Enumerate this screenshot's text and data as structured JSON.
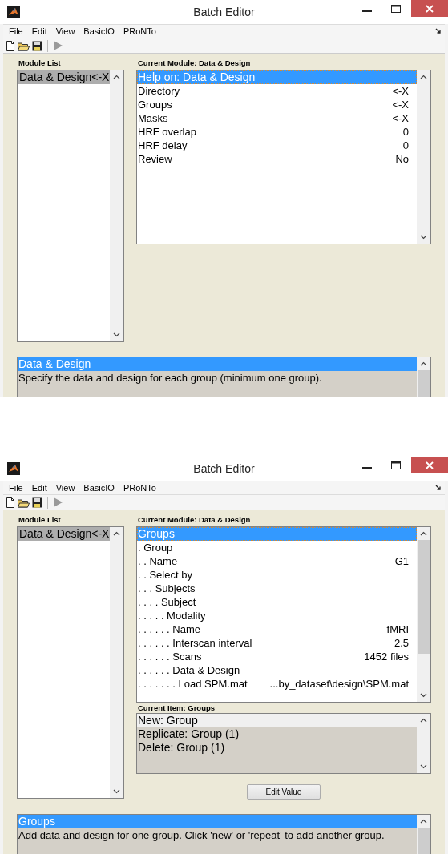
{
  "windows": [
    {
      "title": "Batch Editor",
      "menu": [
        "File",
        "Edit",
        "View",
        "BasicIO",
        "PRoNTo"
      ],
      "module_list_label": "Module List",
      "modules": [
        {
          "label": "Data & Design<-X",
          "selected": true
        }
      ],
      "current_module_label": "Current Module: Data & Design",
      "items": [
        {
          "label": "Help on: Data & Design",
          "selected": true
        },
        {
          "label": "Directory",
          "value": "<-X",
          "selected": false
        },
        {
          "label": "Groups",
          "value": "<-X",
          "selected": false
        },
        {
          "label": "Masks",
          "value": "<-X",
          "selected": false
        },
        {
          "label": "HRF overlap",
          "value": "0",
          "selected": false
        },
        {
          "label": "HRF delay",
          "value": "0",
          "selected": false
        },
        {
          "label": "Review",
          "value": "No",
          "selected": false
        }
      ],
      "help": [
        {
          "text": "Data & Design",
          "selected": true
        },
        {
          "text": "Specify the data and design for each group (minimum one group).",
          "selected": false
        }
      ]
    },
    {
      "title": "Batch Editor",
      "menu": [
        "File",
        "Edit",
        "View",
        "BasicIO",
        "PRoNTo"
      ],
      "module_list_label": "Module List",
      "modules": [
        {
          "label": "Data & Design<-X",
          "selected": true
        }
      ],
      "current_module_label": "Current Module: Data & Design",
      "items": [
        {
          "label": "Groups",
          "selected": true
        },
        {
          "label": ". Group",
          "selected": false
        },
        {
          "label": ". . Name",
          "value": "G1",
          "selected": false
        },
        {
          "label": ". . Select by",
          "selected": false
        },
        {
          "label": ". . . Subjects",
          "selected": false
        },
        {
          "label": ". . . . Subject",
          "selected": false
        },
        {
          "label": ". . . . . Modality",
          "selected": false
        },
        {
          "label": ". . . . . . Name",
          "value": "fMRI",
          "selected": false
        },
        {
          "label": ". . . . . . Interscan interval",
          "value": "2.5",
          "selected": false
        },
        {
          "label": ". . . . . . Scans",
          "value": "1452 files",
          "selected": false
        },
        {
          "label": ". . . . . . Data & Design",
          "selected": false
        },
        {
          "label": ". . . . . . . Load SPM.mat",
          "value": "...by_dataset\\design\\SPM.mat",
          "selected": false
        }
      ],
      "current_item": {
        "label": "Current Item: Groups",
        "options": [
          {
            "text": "New: Group",
            "selected": true
          },
          {
            "text": "Replicate: Group (1)",
            "selected": false
          },
          {
            "text": "Delete: Group (1)",
            "selected": false
          }
        ]
      },
      "edit_button": "Edit Value",
      "help": [
        {
          "text": "Groups",
          "selected": true
        },
        {
          "text": "Add data and design for one group. Click 'new' or 'repeat' to add another group.",
          "selected": false
        }
      ]
    }
  ]
}
